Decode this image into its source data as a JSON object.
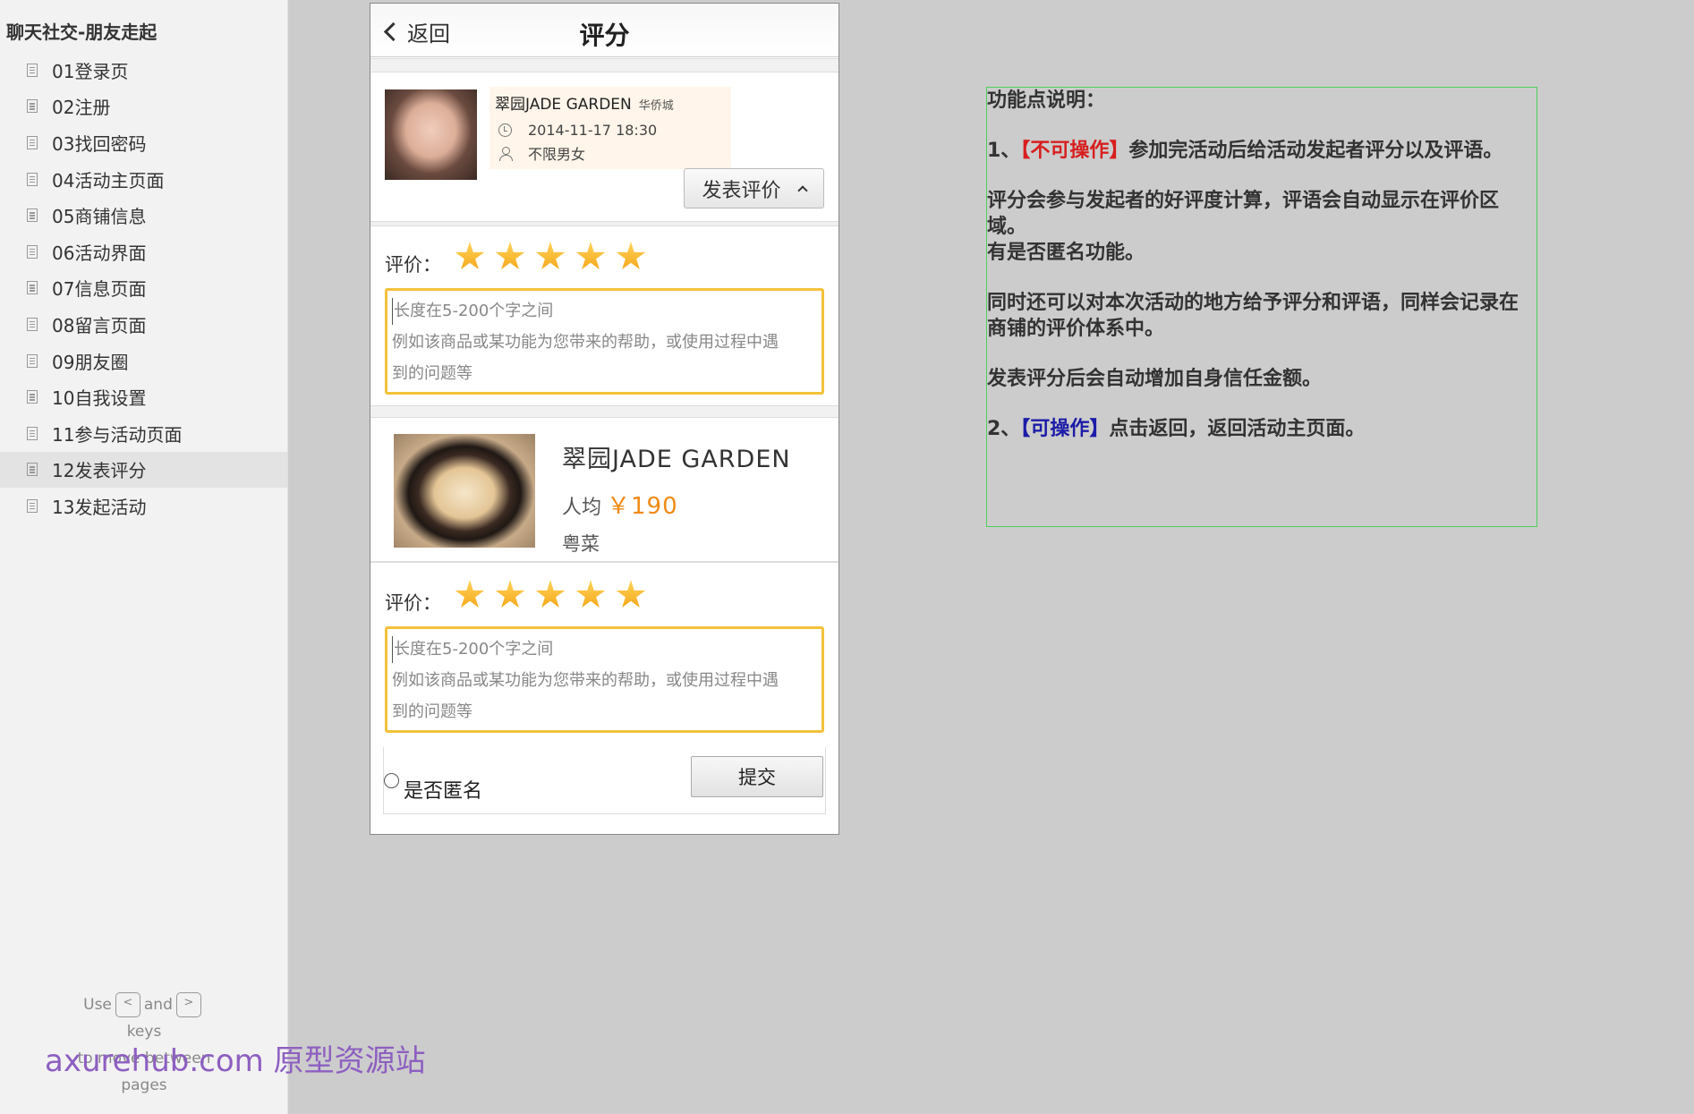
{
  "sidebar": {
    "project_title": "聊天社交-朋友走起",
    "pages": [
      {
        "label": "01登录页"
      },
      {
        "label": "02注册"
      },
      {
        "label": "03找回密码"
      },
      {
        "label": "04活动主页面"
      },
      {
        "label": "05商铺信息"
      },
      {
        "label": "06活动界面"
      },
      {
        "label": "07信息页面"
      },
      {
        "label": "08留言页面"
      },
      {
        "label": "09朋友圈"
      },
      {
        "label": "10自我设置"
      },
      {
        "label": "11参与活动页面"
      },
      {
        "label": "12发表评分",
        "active": true
      },
      {
        "label": "13发起活动"
      }
    ],
    "nav_hint": {
      "use": "Use",
      "key_prev": "<",
      "and": "and",
      "key_next": ">",
      "keys": "keys",
      "to_move": "to move between",
      "pages": "pages"
    },
    "watermark": "axurehub.com 原型资源站"
  },
  "phone": {
    "header": {
      "back_label": "返回",
      "title": "评分"
    },
    "activity": {
      "name": "翠园JADE GARDEN",
      "location": "华侨城",
      "datetime": "2014-11-17 18:30",
      "gender": "不限男女",
      "post_review_label": "发表评价"
    },
    "rating_label": "评价：",
    "ratings": [
      {
        "stars": 5,
        "max": 5
      },
      {
        "stars": 5,
        "max": 5
      }
    ],
    "review_box": {
      "line1": "长度在5-200个字之间",
      "line2": "例如该商品或某功能为您带来的帮助，或使用过程中遇",
      "line3": "到的问题等"
    },
    "restaurant": {
      "name": "翠园JADE GARDEN",
      "avg_label": "人均",
      "avg_price": "￥190",
      "cuisine": "粤菜"
    },
    "footer": {
      "anonymous_label": "是否匿名",
      "submit_label": "提交"
    }
  },
  "notes": {
    "heading": "功能点说明：",
    "item1_prefix": "1、",
    "item1_tag": "【不可操作】",
    "item1_text": "参加完活动后给活动发起者评分以及评语。",
    "para2a": "评分会参与发起者的好评度计算，评语会自动显示在评价区域。",
    "para2b": "有是否匿名功能。",
    "para3": "同时还可以对本次活动的地方给予评分和评语，同样会记录在商铺的评价体系中。",
    "para4": "发表评分后会自动增加自身信任金额。",
    "item2_prefix": "2、",
    "item2_tag": "【可操作】",
    "item2_text": "点击返回，返回活动主页面。"
  },
  "colors": {
    "background": "#cccccc",
    "sidebar": "#f2f2f2",
    "star": "#f4a516",
    "review_border": "#f3c23b",
    "price": "#f08a16",
    "notes_border": "#4fcf5a",
    "tag_red": "#d81e1e",
    "tag_blue": "#1c1ca8",
    "watermark": "#8d5fc1"
  }
}
